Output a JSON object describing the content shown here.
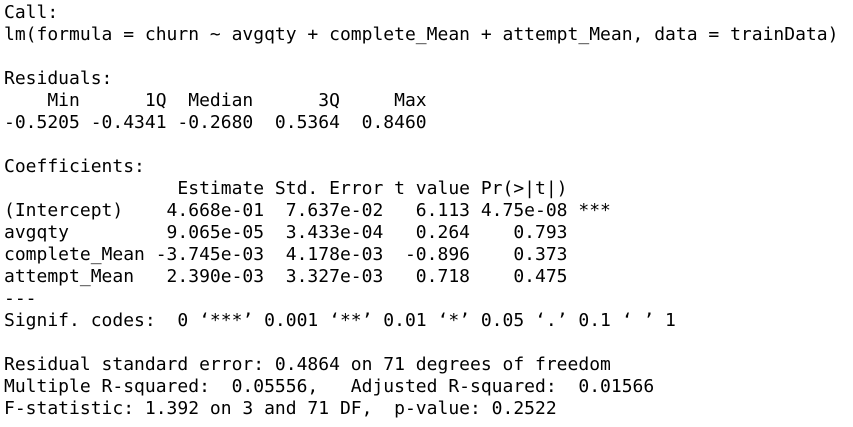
{
  "output": {
    "lines": [
      "Call:",
      "lm(formula = churn ~ avgqty + complete_Mean + attempt_Mean, data = trainData)",
      "",
      "Residuals:",
      "    Min      1Q  Median      3Q     Max ",
      "-0.5205 -0.4341 -0.2680  0.5364  0.8460 ",
      "",
      "Coefficients:",
      "                Estimate Std. Error t value Pr(>|t|)    ",
      "(Intercept)    4.668e-01  7.637e-02   6.113 4.75e-08 ***",
      "avgqty         9.065e-05  3.433e-04   0.264    0.793    ",
      "complete_Mean -3.745e-03  4.178e-03  -0.896    0.373    ",
      "attempt_Mean   2.390e-03  3.327e-03   0.718    0.475    ",
      "---",
      "Signif. codes:  0 ‘***’ 0.001 ‘**’ 0.01 ‘*’ 0.05 ‘.’ 0.1 ‘ ’ 1",
      "",
      "Residual standard error: 0.4864 on 71 degrees of freedom",
      "Multiple R-squared:  0.05556,\tAdjusted R-squared:  0.01566 ",
      "F-statistic: 1.392 on 3 and 71 DF,  p-value: 0.2522"
    ]
  }
}
